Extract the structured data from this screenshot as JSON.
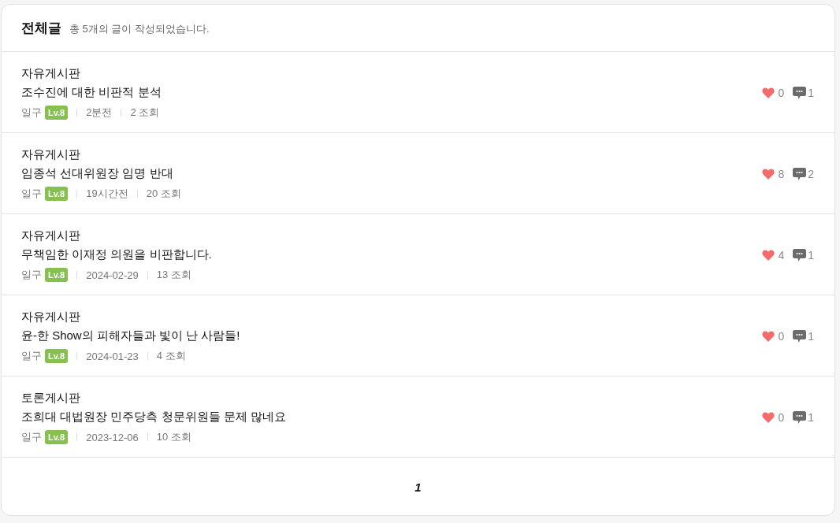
{
  "header": {
    "title": "전체글",
    "subtitle": "총 5개의 글이 작성되었습니다."
  },
  "posts": [
    {
      "board": "자유게시판",
      "title": "조수진에 대한 비판적 분석",
      "author": "일구",
      "level_badge": "Lv.8",
      "time": "2분전",
      "views": "2 조회",
      "likes": "0",
      "comments": "1"
    },
    {
      "board": "자유게시판",
      "title": "임종석 선대위원장 임명 반대",
      "author": "일구",
      "level_badge": "Lv.8",
      "time": "19시간전",
      "views": "20 조회",
      "likes": "8",
      "comments": "2"
    },
    {
      "board": "자유게시판",
      "title": "무책임한 이재정 의원을 비판합니다.",
      "author": "일구",
      "level_badge": "Lv.8",
      "time": "2024-02-29",
      "views": "13 조회",
      "likes": "4",
      "comments": "1"
    },
    {
      "board": "자유게시판",
      "title": "윤-한 Show의 피해자들과 빛이 난 사람들!",
      "author": "일구",
      "level_badge": "Lv.8",
      "time": "2024-01-23",
      "views": "4 조회",
      "likes": "0",
      "comments": "1"
    },
    {
      "board": "토론게시판",
      "title": "조희대 대법원장 민주당측 청문위원들 문제 많네요",
      "author": "일구",
      "level_badge": "Lv.8",
      "time": "2023-12-06",
      "views": "10 조회",
      "likes": "0",
      "comments": "1"
    }
  ],
  "pagination": [
    {
      "label": "1",
      "selected": true
    }
  ]
}
